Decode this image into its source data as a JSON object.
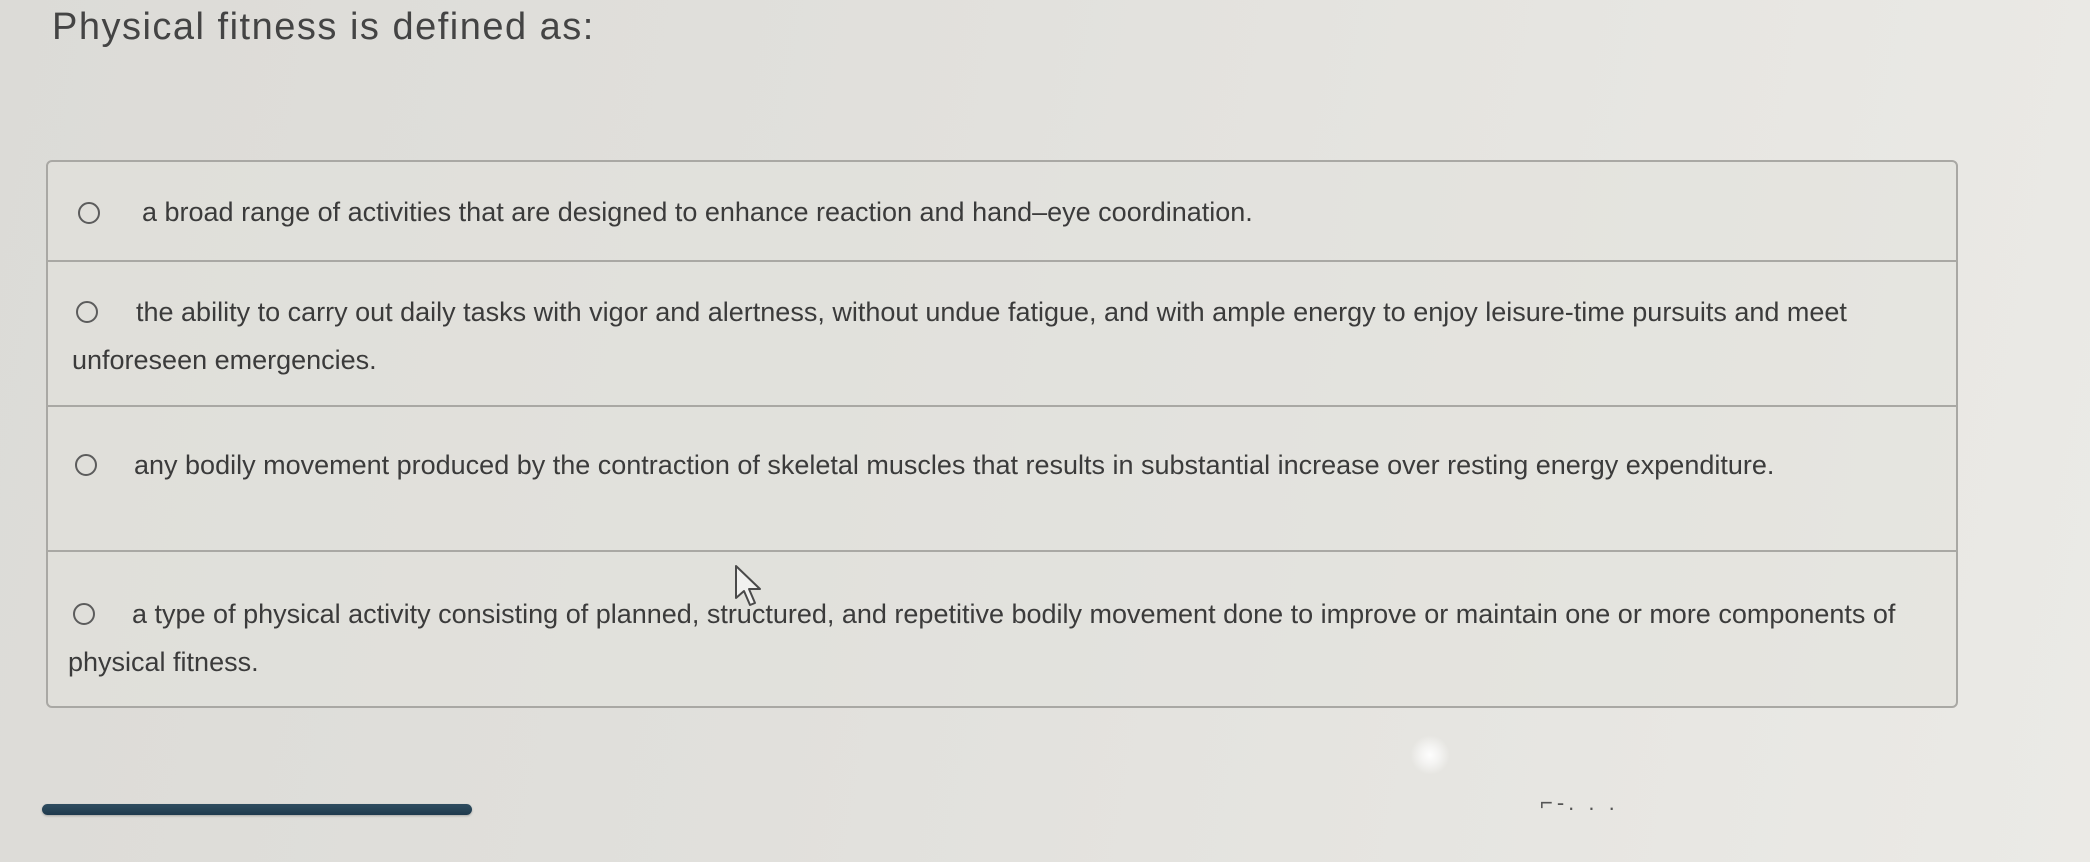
{
  "question": {
    "prompt": "Physical fitness is defined as:"
  },
  "options": [
    {
      "text": "a broad range of activities that are designed to enhance reaction and hand–eye coordination.",
      "selected": false
    },
    {
      "text": "the ability to carry out daily tasks with vigor and alertness, without undue fatigue, and with ample energy to enjoy leisure-time pursuits and meet unforeseen emergencies.",
      "selected": false
    },
    {
      "text": "any bodily movement produced by the contraction of skeletal muscles that results in substantial increase over resting energy expenditure.",
      "selected": false
    },
    {
      "text": "a type of physical activity consisting of planned, structured, and repetitive bodily movement done to improve or maintain one or more components of physical fitness.",
      "selected": false
    }
  ],
  "colors": {
    "background": "#e1e0dc",
    "border": "#a9a8a4",
    "text": "#3b3b3b",
    "bar": "#1f3a4d"
  },
  "icons": {
    "cursor": "mouse-pointer-icon",
    "radio": "radio-button-icon"
  }
}
